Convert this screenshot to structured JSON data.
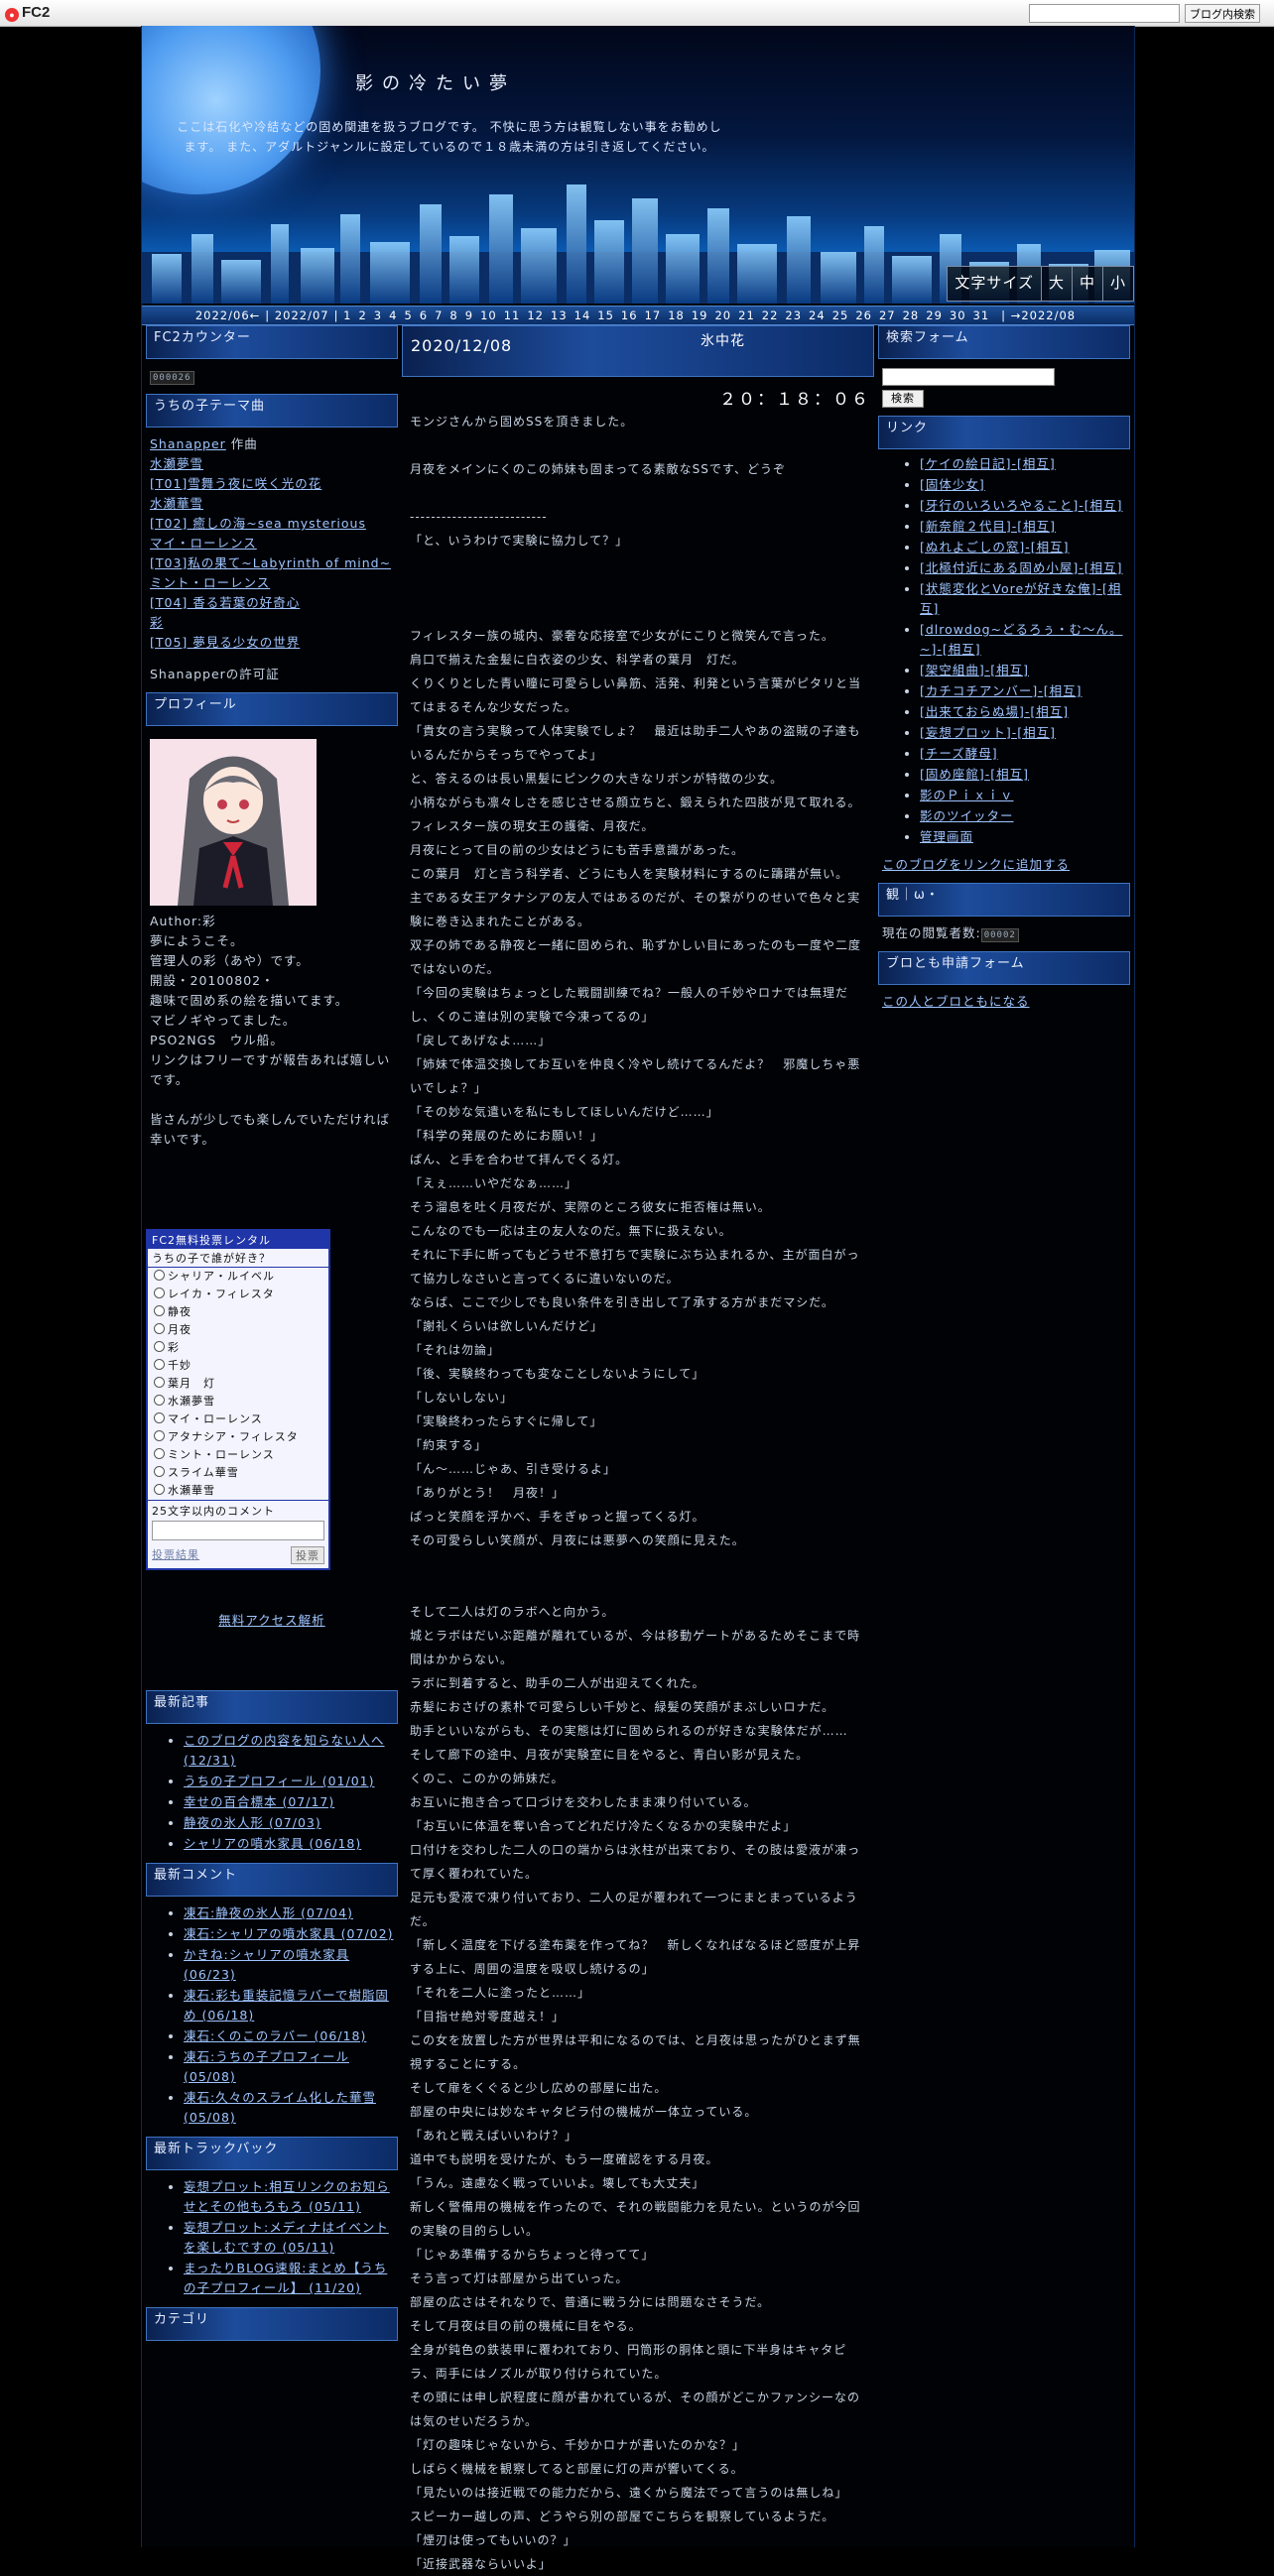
{
  "topbar": {
    "logo": "FC2",
    "search_placeholder": "",
    "search_button": "ブログ内検索"
  },
  "header": {
    "title": "影の冷たい夢",
    "description": "ここは石化や冷結などの固め関連を扱うブログです。 不快に思う方は観覧しない事をお勧めします。 また、アダルトジャンルに設定しているので１８歳未満の方は引き返してください。",
    "font_size_label": "文字サイズ",
    "font_sizes": [
      "大",
      "中",
      "小"
    ]
  },
  "calendar": {
    "prev": "2022/06←",
    "current": "2022/07",
    "days": [
      "1",
      "2",
      "3",
      "4",
      "5",
      "6",
      "7",
      "8",
      "9",
      "10",
      "11",
      "12",
      "13",
      "14",
      "15",
      "16",
      "17",
      "18",
      "19",
      "20",
      "21",
      "22",
      "23",
      "24",
      "25",
      "26",
      "27",
      "28",
      "29",
      "30",
      "31"
    ],
    "next": "→2022/08"
  },
  "left": {
    "counter_title": "FC2カウンター",
    "counter_value": "000026",
    "theme_title": "うちの子テーマ曲",
    "theme_author": "Shanapper",
    "theme_author_suffix": "作曲",
    "theme_songs": [
      "水瀬夢雪",
      "[T01]雪舞う夜に咲く光の花",
      "水瀬華雪",
      "[T02] 癒しの海~sea mysterious",
      "マイ・ローレンス",
      "[T03]私の果て~Labyrinth of mind~",
      "ミント・ローレンス",
      "[T04] 香る若葉の好奇心",
      "彩",
      "[T05] 夢見る少女の世界"
    ],
    "theme_permission": "Shanapperの許可証",
    "profile_title": "プロフィール",
    "profile_lines": [
      "Author:彩",
      "夢にようこそ。",
      "管理人の彩（あや）です。",
      "開設・20100802・",
      "趣味で固め系の絵を描いてます。",
      "マビノギやってました。",
      "PSO2NGS　ウル船。",
      "リンクはフリーですが報告あれば嬉しいです。",
      "",
      "皆さんが少しでも楽しんでいただければ幸いです。"
    ],
    "poll_header": "FC2無料投票レンタル",
    "poll_question": "うちの子で誰が好き？",
    "poll_options": [
      "シャリア・ルイベル",
      "レイカ・フィレスタ",
      "静夜",
      "月夜",
      "彩",
      "千妙",
      "葉月　灯",
      "水瀬夢雪",
      "マイ・ローレンス",
      "アタナシア・フィレスタ",
      "ミント・ローレンス",
      "スライム華雪",
      "水瀬華雪"
    ],
    "poll_comment_label": "25文字以内のコメント",
    "poll_result": "投票結果",
    "poll_submit": "投票",
    "access_link": "無料アクセス解析",
    "recent_title": "最新記事",
    "recent": [
      "このブログの内容を知らない人へ(12/31)",
      "うちの子プロフィール (01/01)",
      "幸せの百合標本 (07/17)",
      "静夜の氷人形 (07/03)",
      "シャリアの噴水家具 (06/18)"
    ],
    "comments_title": "最新コメント",
    "comments": [
      "凍石:静夜の氷人形 (07/04)",
      "凍石:シャリアの噴水家具 (07/02)",
      "かきね:シャリアの噴水家具 (06/23)",
      "凍石:彩も重装記憶ラバーで樹脂固め (06/18)",
      "凍石:くのこのラバー (06/18)",
      "凍石:うちの子プロフィール (05/08)",
      "凍石:久々のスライム化した華雪 (05/08)"
    ],
    "trackback_title": "最新トラックバック",
    "trackbacks": [
      "妄想プロット:相互リンクのお知らせとその他もろもろ (05/11)",
      "妄想プロット:メディナはイベントを楽しむですの (05/11)",
      "まったりBLOG速報:まとめ【うちの子プロフィール】 (11/20)"
    ],
    "category_title": "カテゴリ"
  },
  "entry": {
    "date": "2020/12/08",
    "title": "氷中花",
    "time": "２０：１８：０６",
    "lines": [
      "モンジさんから固めSSを頂きました。",
      "",
      "月夜をメインにくのこの姉妹も固まってる素敵なSSです、どうぞ",
      "",
      "--------------------------",
      "「と、いうわけで実験に協力して？」",
      "",
      "",
      "",
      "フィレスター族の城内、豪奢な応接室で少女がにこりと微笑んで言った。",
      "肩口で揃えた金髪に白衣姿の少女、科学者の葉月　灯だ。",
      "くりくりとした青い瞳に可愛らしい鼻筋、活発、利発という言葉がピタリと当てはまるそんな少女だった。",
      "「貴女の言う実験って人体実験でしょ？　最近は助手二人やあの盗賊の子達もいるんだからそっちでやってよ」",
      "と、答えるのは長い黒髪にピンクの大きなリボンが特徴の少女。",
      "小柄ながらも凛々しさを感じさせる顔立ちと、鍛えられた四肢が見て取れる。",
      "フィレスター族の現女王の護衛、月夜だ。",
      "月夜にとって目の前の少女はどうにも苦手意識があった。",
      "この葉月　灯と言う科学者、どうにも人を実験材料にするのに躊躇が無い。",
      "主である女王アタナシアの友人ではあるのだが、その繋がりのせいで色々と実験に巻き込まれたことがある。",
      "双子の姉である静夜と一緒に固められ、恥ずかしい目にあったのも一度や二度ではないのだ。",
      "「今回の実験はちょっとした戦闘訓練でね？一般人の千妙やロナでは無理だし、くのこ達は別の実験で今凍ってるの」",
      "「戻してあげなよ……」",
      "「姉妹で体温交換してお互いを仲良く冷やし続けてるんだよ？　邪魔しちゃ悪いでしょ？」",
      "「その妙な気遣いを私にもしてほしいんだけど……」",
      "「科学の発展のためにお願い！」",
      "ぱん、と手を合わせて拝んでくる灯。",
      "「えぇ……いやだなぁ……」",
      "そう溜息を吐く月夜だが、実際のところ彼女に拒否権は無い。",
      "こんなのでも一応は主の友人なのだ。無下に扱えない。",
      "それに下手に断ってもどうせ不意打ちで実験にぶち込まれるか、主が面白がって協力しなさいと言ってくるに違いないのだ。",
      "ならば、ここで少しでも良い条件を引き出して了承する方がまだマシだ。",
      "「謝礼くらいは欲しいんだけど」",
      "「それは勿論」",
      "「後、実験終わっても変なことしないようにして」",
      "「しないしない」",
      "「実験終わったらすぐに帰して」",
      "「約束する」",
      "「ん～……じゃあ、引き受けるよ」",
      "「ありがとう！　月夜！」",
      "ぱっと笑顔を浮かべ、手をぎゅっと握ってくる灯。",
      "その可愛らしい笑顔が、月夜には悪夢への笑顔に見えた。",
      "",
      "",
      "そして二人は灯のラボへと向かう。",
      "城とラボはだいぶ距離が離れているが、今は移動ゲートがあるためそこまで時間はかからない。",
      "ラボに到着すると、助手の二人が出迎えてくれた。",
      "赤髪におさげの素朴で可愛らしい千妙と、緑髪の笑顔がまぶしいロナだ。",
      "助手といいながらも、その実態は灯に固められるのが好きな実験体だが……",
      "そして廊下の途中、月夜が実験室に目をやると、青白い影が見えた。",
      "くのこ、このかの姉妹だ。",
      "お互いに抱き合って口づけを交わしたまま凍り付いている。",
      "「お互いに体温を奪い合ってどれだけ冷たくなるかの実験中だよ」",
      "口付けを交わした二人の口の端からは氷柱が出来ており、その肢は愛液が凍って厚く覆われていた。",
      "足元も愛液で凍り付いており、二人の足が覆われて一つにまとまっているようだ。",
      "「新しく温度を下げる塗布薬を作ってね？　新しくなればなるほど感度が上昇する上に、周囲の温度を吸収し続けるの」",
      "「それを二人に塗ったと……」",
      "「目指せ絶対零度越え！」",
      "この女を放置した方が世界は平和になるのでは、と月夜は思ったがひとまず無視することにする。",
      "そして扉をくぐると少し広めの部屋に出た。",
      "部屋の中央には妙なキャタピラ付の機械が一体立っている。",
      "「あれと戦えばいいわけ？」",
      "道中でも説明を受けたが、もう一度確認をする月夜。",
      "「うん。遠慮なく戦っていいよ。壊しても大丈夫」",
      "新しく警備用の機械を作ったので、それの戦闘能力を見たい。というのが今回の実験の目的らしい。",
      "「じゃあ準備するからちょっと待ってて」",
      "そう言って灯は部屋から出ていった。",
      "部屋の広さはそれなりで、普通に戦う分には問題なさそうだ。",
      "そして月夜は目の前の機械に目をやる。",
      "全身が鈍色の鉄装甲に覆われており、円筒形の胴体と頭に下半身はキャタピラ、両手にはノズルが取り付けられていた。",
      "その頭には申し訳程度に顔が書かれているが、その顔がどこかファンシーなのは気のせいだろうか。",
      "「灯の趣味じゃないから、千妙かロナが書いたのかな？」",
      "しばらく機械を観察してると部屋に灯の声が響いてくる。",
      "「見たいのは接近戦での能力だから、遠くから魔法でって言うのは無しね」",
      "スピーカー越しの声、どうやら別の部屋でこちらを観察しているようだ。",
      "「煙刃は使ってもいいの？」",
      "「近接武器ならいいよ」"
    ]
  },
  "right": {
    "search_title": "検索フォーム",
    "search_button": "検索",
    "links_title": "リンク",
    "links": [
      "[ケイの絵日記]-[相互]",
      "[固体少女]",
      "[牙行のいろいろやること]-[相互]",
      "[新奈館２代目]-[相互]",
      "[ぬれよごしの窓]-[相互]",
      "[北極付近にある固め小屋]-[相互]",
      "[状態変化とVoreが好きな俺]-[相互]",
      "[dlrowdog~どるろぅ・む～ん。~]-[相互]",
      "[架空組曲]-[相互]",
      "[カチコチアンバー]-[相互]",
      "[出来ておらぬ場]-[相互]",
      "[妄想プロット]-[相互]",
      "[チーズ酵母]",
      "[固め座館]-[相互]",
      "影のＰｉｘｉｖ",
      "影のツイッター",
      "管理画面"
    ],
    "add_link": "このブログをリンクに追加する",
    "visitors_title": "観｜ω・",
    "visitors_label": "現在の閲覧者数:",
    "visitors_value": "00002",
    "friend_title": "ブロとも申請フォーム",
    "friend_link": "この人とブロともになる"
  }
}
